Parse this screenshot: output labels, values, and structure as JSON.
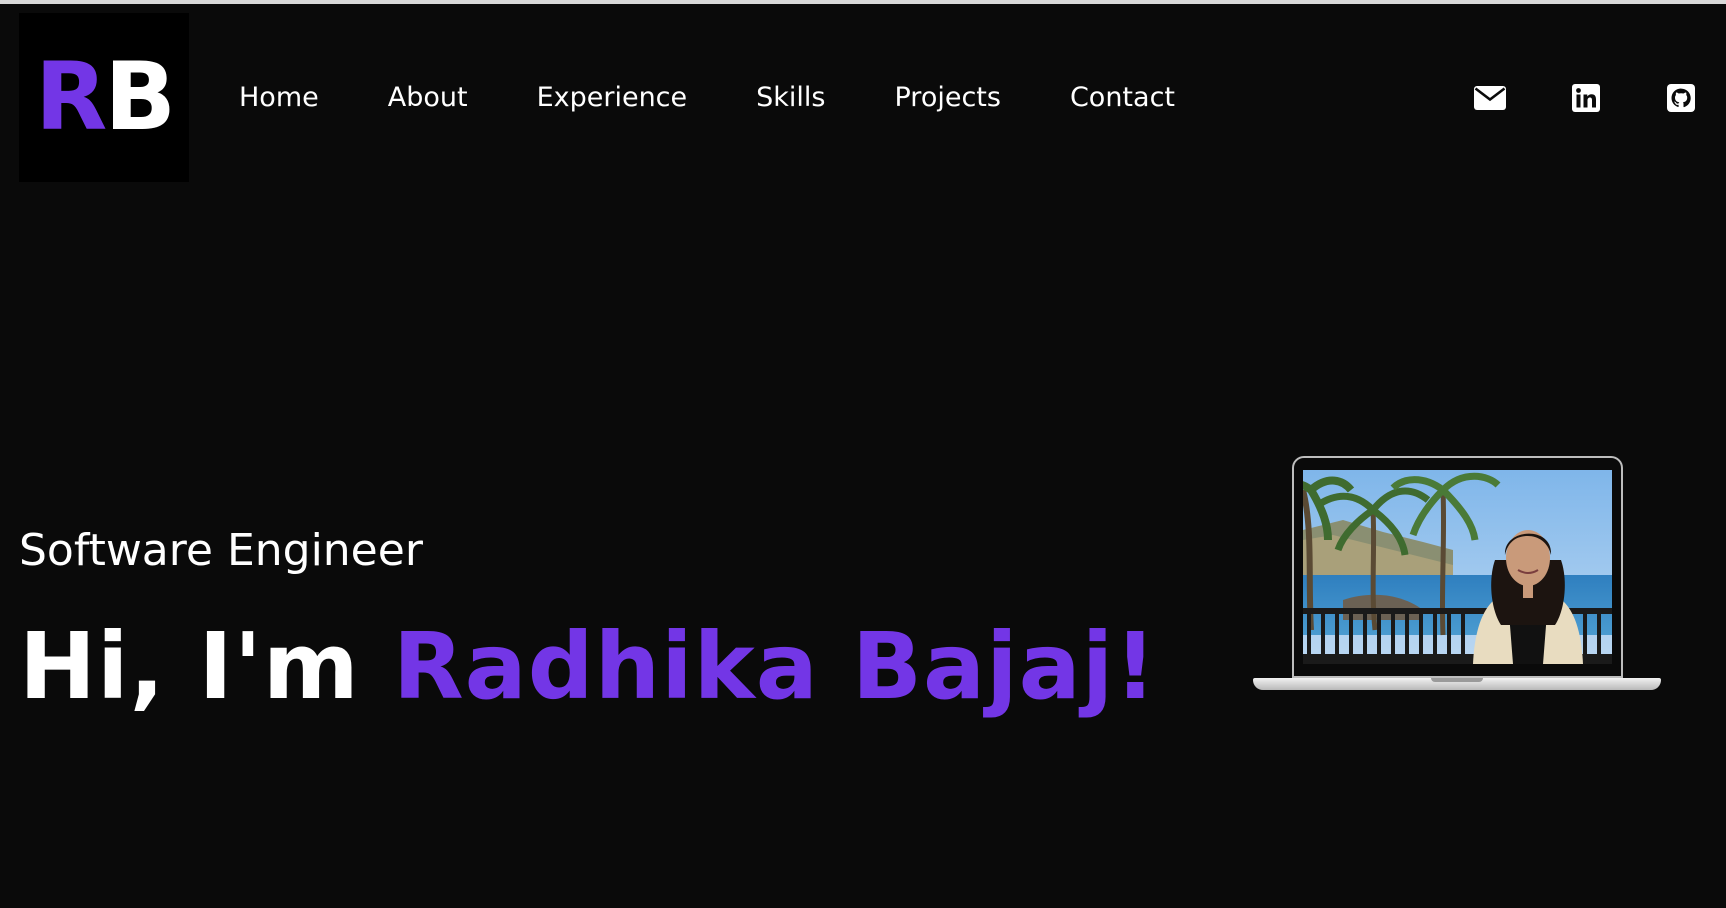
{
  "logo": {
    "first_letter": "R",
    "second_letter": "B"
  },
  "nav": {
    "items": [
      {
        "label": "Home"
      },
      {
        "label": "About"
      },
      {
        "label": "Experience"
      },
      {
        "label": "Skills"
      },
      {
        "label": "Projects"
      },
      {
        "label": "Contact"
      }
    ]
  },
  "social": {
    "icons": [
      "envelope-icon",
      "linkedin-icon",
      "github-icon"
    ]
  },
  "hero": {
    "subtitle": "Software Engineer",
    "greeting": "Hi, I'm ",
    "name": "Radhika Bajaj!"
  },
  "colors": {
    "background": "#0a0a0a",
    "accent": "#7336e6",
    "text": "#ffffff"
  }
}
